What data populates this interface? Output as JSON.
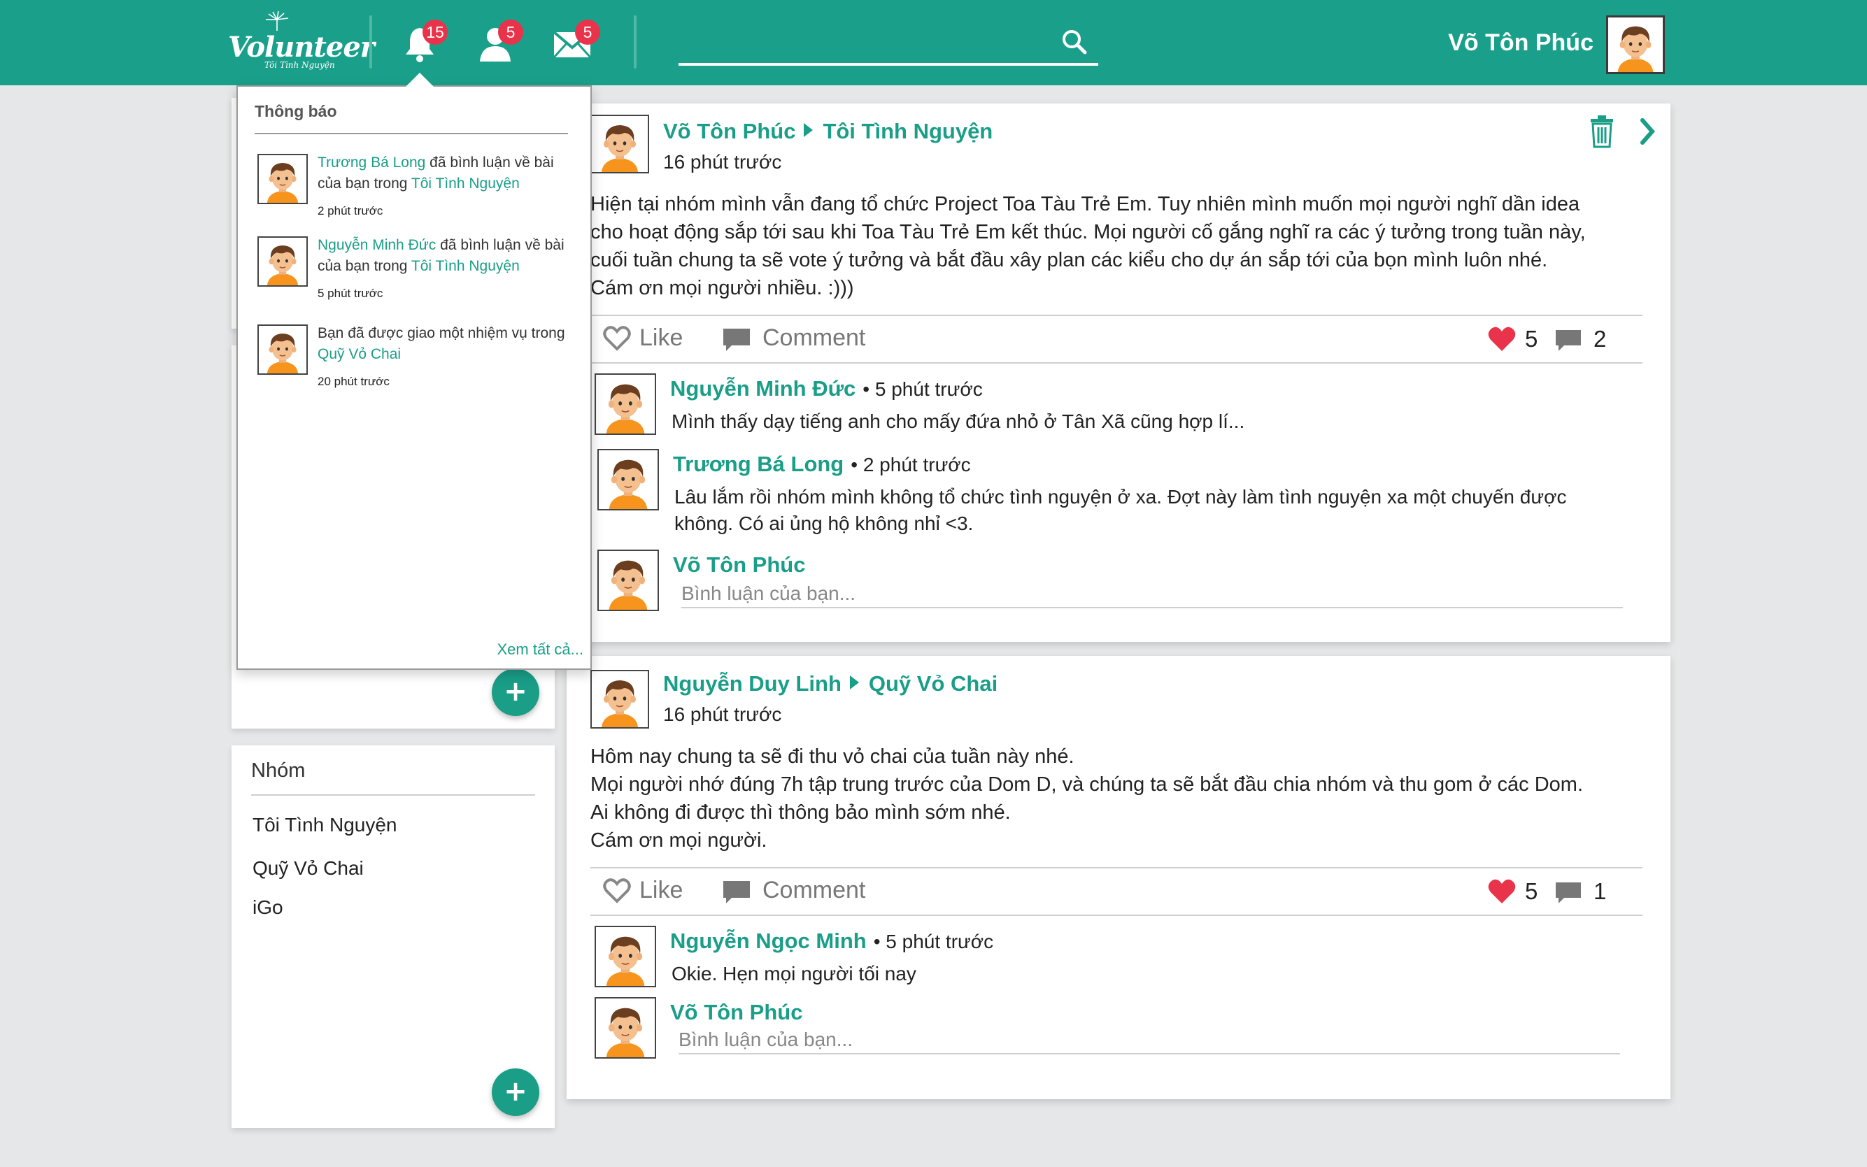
{
  "topbar": {
    "logo_text": "Volunteer",
    "logo_tagline": "Tôi Tình Nguyện",
    "notifications_count": "15",
    "friends_count": "5",
    "messages_count": "5",
    "user_name": "Võ Tôn Phúc",
    "brand_color": "#1aa08a"
  },
  "notifications": {
    "title": "Thông báo",
    "see_all": "Xem tất cả...",
    "items": [
      {
        "actor": "Trương Bá Long",
        "text": " đã bình luận về bài của bạn trong ",
        "group": "Tôi Tình Nguyện",
        "time": "2 phút trước"
      },
      {
        "actor": "Nguyễn Minh Đức",
        "text": " đã bình luận về bài của bạn trong ",
        "group": "Tôi Tình Nguyện",
        "time": "5 phút trước"
      },
      {
        "actor": "",
        "text": "Bạn đã được giao một nhiệm vụ trong ",
        "group": "Quỹ Vỏ Chai",
        "time": "20 phút trước"
      }
    ]
  },
  "sidebar": {
    "groups_title": "Nhóm",
    "groups": [
      "Tôi Tình Nguyện",
      "Quỹ Vỏ Chai",
      "iGo"
    ],
    "add_label": "+"
  },
  "posts": [
    {
      "author": "Võ Tôn Phúc",
      "group": "Tôi Tình Nguyện",
      "time": "16 phút trước",
      "body": [
        "Hiện tại nhóm mình vẫn đang tổ chức Project Toa Tàu Trẻ Em. Tuy nhiên mình muốn mọi người nghĩ dần idea",
        "cho hoạt động sắp tới sau khi Toa Tàu Trẻ Em kết thúc. Mọi người cố gắng nghĩ ra các ý tưởng trong tuần này,",
        "cuối tuần chung ta sẽ vote ý tưởng và bắt đầu xây plan các kiểu cho dự án sắp tới của bọn mình luôn nhé.",
        "Cám ơn mọi người nhiều. :)))"
      ],
      "like_label": "Like",
      "comment_label": "Comment",
      "likes": "5",
      "comments_count": "2",
      "comments": [
        {
          "author": "Nguyễn Minh Đức",
          "time": "• 5 phút trước",
          "text": [
            "Mình thấy dạy tiếng anh cho mấy đứa nhỏ ở Tân Xã cũng hợp lí..."
          ]
        },
        {
          "author": "Trương Bá Long",
          "time": "• 2 phút trước",
          "text": [
            "Lâu lắm rồi nhóm mình không tổ chức tình nguyện ở xa. Đợt này làm tình nguyện xa một chuyến được",
            "không. Có ai ủng hộ không nhỉ <3."
          ]
        }
      ],
      "reply_author": "Võ Tôn Phúc",
      "reply_placeholder": "Bình luận của bạn..."
    },
    {
      "author": "Nguyễn Duy Linh",
      "group": "Quỹ Vỏ Chai",
      "time": "16 phút trước",
      "body": [
        "Hôm nay chung ta sẽ đi thu vỏ chai của tuần này nhé.",
        "Mọi người nhớ đúng 7h tập trung trước của Dom D, và chúng ta sẽ bắt đầu chia nhóm và thu gom ở các Dom.",
        "Ai không đi được thì thông bảo mình sớm nhé.",
        "Cám ơn mọi người."
      ],
      "like_label": "Like",
      "comment_label": "Comment",
      "likes": "5",
      "comments_count": "1",
      "comments": [
        {
          "author": "Nguyễn Ngọc Minh",
          "time": "• 5 phút trước",
          "text": [
            "Okie. Hẹn mọi người tối nay"
          ]
        }
      ],
      "reply_author": "Võ Tôn Phúc",
      "reply_placeholder": "Bình luận của bạn..."
    }
  ]
}
